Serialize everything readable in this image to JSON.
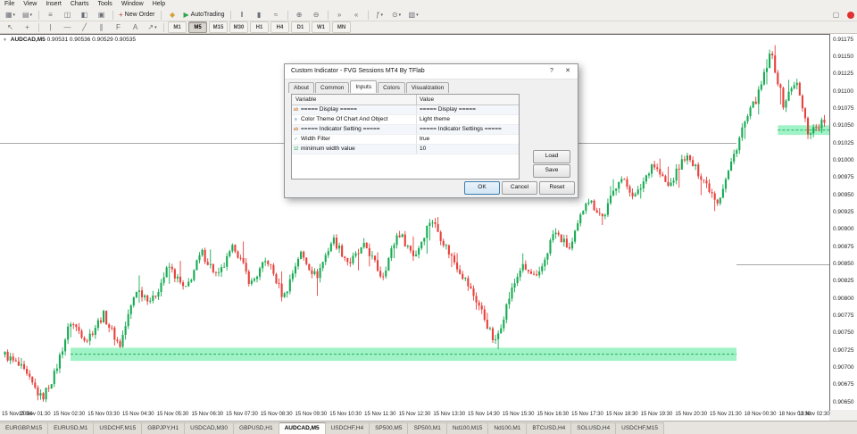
{
  "menu_bar": {
    "items": [
      "File",
      "View",
      "Insert",
      "Charts",
      "Tools",
      "Window",
      "Help"
    ]
  },
  "toolbar_main": {
    "items": [
      {
        "t": "btn",
        "name": "new-chart-button",
        "glyph": "▦",
        "caret": true
      },
      {
        "t": "btn",
        "name": "profiles-button",
        "glyph": "▤",
        "caret": true
      },
      {
        "t": "sep"
      },
      {
        "t": "btn",
        "name": "market-watch-button",
        "glyph": "≡"
      },
      {
        "t": "btn",
        "name": "data-window-button",
        "glyph": "◫"
      },
      {
        "t": "btn",
        "name": "navigator-button",
        "glyph": "◧"
      },
      {
        "t": "btn",
        "name": "terminal-button",
        "glyph": "▣"
      },
      {
        "t": "sep"
      },
      {
        "t": "btn",
        "name": "new-order-button",
        "glyph": "+",
        "glyph_color": "#c43b3b",
        "label": "New Order"
      },
      {
        "t": "sep"
      },
      {
        "t": "btn",
        "name": "metaeditor-button",
        "glyph": "◆",
        "glyph_color": "#d2a23c"
      },
      {
        "t": "btn",
        "name": "autotrading-button",
        "glyph": "▶",
        "glyph_color": "#2da44e",
        "label": "AutoTrading"
      },
      {
        "t": "sep"
      },
      {
        "t": "btn",
        "name": "bar-chart-button",
        "glyph": "‖"
      },
      {
        "t": "btn",
        "name": "candlestick-chart-button",
        "glyph": "▮"
      },
      {
        "t": "btn",
        "name": "line-chart-button",
        "glyph": "≈"
      },
      {
        "t": "sep"
      },
      {
        "t": "btn",
        "name": "zoom-in-button",
        "glyph": "⊕"
      },
      {
        "t": "btn",
        "name": "zoom-out-button",
        "glyph": "⊖"
      },
      {
        "t": "sep"
      },
      {
        "t": "btn",
        "name": "auto-scroll-button",
        "glyph": "»"
      },
      {
        "t": "btn",
        "name": "chart-shift-button",
        "glyph": "«"
      },
      {
        "t": "sep"
      },
      {
        "t": "btn",
        "name": "indicators-button",
        "glyph": "ƒ",
        "caret": true
      },
      {
        "t": "btn",
        "name": "periods-button",
        "glyph": "⊙",
        "caret": true
      },
      {
        "t": "btn",
        "name": "templates-button",
        "glyph": "▧",
        "caret": true
      }
    ]
  },
  "toolbar_right": {
    "window_glyph": "▢"
  },
  "toolbar_drawing": {
    "items": [
      {
        "t": "btn",
        "name": "cursor-button",
        "glyph": "↖"
      },
      {
        "t": "btn",
        "name": "crosshair-button",
        "glyph": "+"
      },
      {
        "t": "sep"
      },
      {
        "t": "btn",
        "name": "vertical-line-button",
        "glyph": "|"
      },
      {
        "t": "btn",
        "name": "horizontal-line-button",
        "glyph": "—"
      },
      {
        "t": "btn",
        "name": "trendline-button",
        "glyph": "╱"
      },
      {
        "t": "btn",
        "name": "channel-button",
        "glyph": "∥"
      },
      {
        "t": "btn",
        "name": "fibonacci-button",
        "glyph": "F"
      },
      {
        "t": "btn",
        "name": "text-button",
        "glyph": "A"
      },
      {
        "t": "btn",
        "name": "arrows-button",
        "glyph": "↗",
        "caret": true
      },
      {
        "t": "sep"
      }
    ],
    "timeframes": [
      "M1",
      "M5",
      "M15",
      "M30",
      "H1",
      "H4",
      "D1",
      "W1",
      "MN"
    ],
    "active_timeframe": "M5"
  },
  "chart": {
    "symbol_label": "AUDCAD,M5",
    "ohlc": "0.90531 0.90536 0.90529 0.90535",
    "one_click_arrow": "▼"
  },
  "chart_data": {
    "type": "candlestick",
    "symbol": "AUDCAD",
    "timeframe": "M5",
    "y_min": 0.9064,
    "y_max": 0.91183,
    "y_ticks": [
      "0.91175",
      "0.91150",
      "0.91125",
      "0.91100",
      "0.91075",
      "0.91050",
      "0.91025",
      "0.91000",
      "0.90975",
      "0.90950",
      "0.90925",
      "0.90900",
      "0.90875",
      "0.90850",
      "0.90825",
      "0.90800",
      "0.90775",
      "0.90750",
      "0.90725",
      "0.90700",
      "0.90675",
      "0.90650"
    ],
    "x_ticks": [
      "15 Nov 2024",
      "15 Nov 01:30",
      "15 Nov 02:30",
      "15 Nov 03:30",
      "15 Nov 04:30",
      "15 Nov 05:30",
      "15 Nov 06:30",
      "15 Nov 07:30",
      "15 Nov 08:30",
      "15 Nov 09:30",
      "15 Nov 10:30",
      "15 Nov 11:30",
      "15 Nov 12:30",
      "15 Nov 13:30",
      "15 Nov 14:30",
      "15 Nov 15:30",
      "15 Nov 16:30",
      "15 Nov 17:30",
      "15 Nov 18:30",
      "15 Nov 19:30",
      "15 Nov 20:30",
      "15 Nov 21:30",
      "18 Nov 00:30",
      "18 Nov 01:30",
      "18 Nov 02:30"
    ],
    "candle_count": 300,
    "price_path": [
      [
        0.0,
        0.9072
      ],
      [
        0.02,
        0.907
      ],
      [
        0.045,
        0.90656
      ],
      [
        0.06,
        0.9069
      ],
      [
        0.08,
        0.90768
      ],
      [
        0.1,
        0.90742
      ],
      [
        0.12,
        0.90778
      ],
      [
        0.14,
        0.90732
      ],
      [
        0.16,
        0.90815
      ],
      [
        0.18,
        0.90798
      ],
      [
        0.2,
        0.90848
      ],
      [
        0.22,
        0.90812
      ],
      [
        0.24,
        0.90868
      ],
      [
        0.26,
        0.90832
      ],
      [
        0.28,
        0.90878
      ],
      [
        0.3,
        0.90822
      ],
      [
        0.32,
        0.90858
      ],
      [
        0.34,
        0.90802
      ],
      [
        0.36,
        0.90868
      ],
      [
        0.38,
        0.90832
      ],
      [
        0.4,
        0.90888
      ],
      [
        0.42,
        0.90852
      ],
      [
        0.44,
        0.90878
      ],
      [
        0.46,
        0.90832
      ],
      [
        0.48,
        0.90898
      ],
      [
        0.5,
        0.90862
      ],
      [
        0.52,
        0.90918
      ],
      [
        0.54,
        0.90872
      ],
      [
        0.56,
        0.90832
      ],
      [
        0.58,
        0.90788
      ],
      [
        0.598,
        0.90735
      ],
      [
        0.615,
        0.90802
      ],
      [
        0.63,
        0.90848
      ],
      [
        0.65,
        0.90828
      ],
      [
        0.67,
        0.90898
      ],
      [
        0.69,
        0.90872
      ],
      [
        0.71,
        0.90948
      ],
      [
        0.73,
        0.90918
      ],
      [
        0.75,
        0.90978
      ],
      [
        0.77,
        0.90948
      ],
      [
        0.79,
        0.90998
      ],
      [
        0.81,
        0.90962
      ],
      [
        0.83,
        0.91008
      ],
      [
        0.85,
        0.90978
      ],
      [
        0.87,
        0.90942
      ],
      [
        0.885,
        0.90992
      ],
      [
        0.9,
        0.91048
      ],
      [
        0.92,
        0.91098
      ],
      [
        0.935,
        0.91158
      ],
      [
        0.95,
        0.91082
      ],
      [
        0.965,
        0.91118
      ],
      [
        0.98,
        0.91042
      ],
      [
        1.0,
        0.91058
      ]
    ],
    "fvg_zones": [
      {
        "t_start": 0.085,
        "t_end": 0.888,
        "price_high": 0.9073,
        "price_low": 0.90711
      },
      {
        "t_start": 0.938,
        "t_end": 1.0,
        "price_high": 0.91052,
        "price_low": 0.91038
      }
    ],
    "levels": [
      {
        "t_start": 0.0,
        "t_end": 0.888,
        "price": 0.91026
      },
      {
        "t_start": 0.888,
        "t_end": 1.0,
        "price": 0.9085
      }
    ],
    "colors": {
      "bull": "#17ab53",
      "bear": "#e8403b",
      "background": "#ffffff",
      "zone_fill": "#42e88d",
      "zone_line": "#12a552",
      "level_line": "#8a8a8a"
    }
  },
  "dialog": {
    "title": "Custom Indicator - FVG Sessions MT4 By TFlab",
    "help_label": "?",
    "close_label": "✕",
    "tabs": [
      "About",
      "Common",
      "Inputs",
      "Colors",
      "Visualization"
    ],
    "active_tab": "Inputs",
    "table": {
      "headers": [
        "Variable",
        "Value"
      ],
      "rows": [
        {
          "type": "str",
          "variable": "===== Display =====",
          "value": "===== Display ====="
        },
        {
          "type": "enum",
          "variable": "Color Theme Of Chart And Object",
          "value": "Light theme"
        },
        {
          "type": "str",
          "variable": "===== Indicator Setting =====",
          "value": "===== Indicator Settings ====="
        },
        {
          "type": "bool",
          "variable": "Width Filter",
          "value": "true"
        },
        {
          "type": "int",
          "variable": "minimum width value",
          "value": "10"
        }
      ]
    },
    "buttons": {
      "load": "Load",
      "save": "Save",
      "ok": "OK",
      "cancel": "Cancel",
      "reset": "Reset"
    }
  },
  "symbol_tabs": {
    "active": "AUDCAD,M5",
    "tabs": [
      "EURGBP,M15",
      "EURUSD,M1",
      "USDCHF,M15",
      "GBPJPY,H1",
      "USDCAD,M30",
      "GBPUSD,H1",
      "AUDCAD,M5",
      "USDCHF,H4",
      "SP500,M5",
      "SP500,M1",
      "Nd100,M15",
      "Nd100,M1",
      "BTCUSD,H4",
      "SOLUSD,H4",
      "USDCHF,M15"
    ]
  }
}
